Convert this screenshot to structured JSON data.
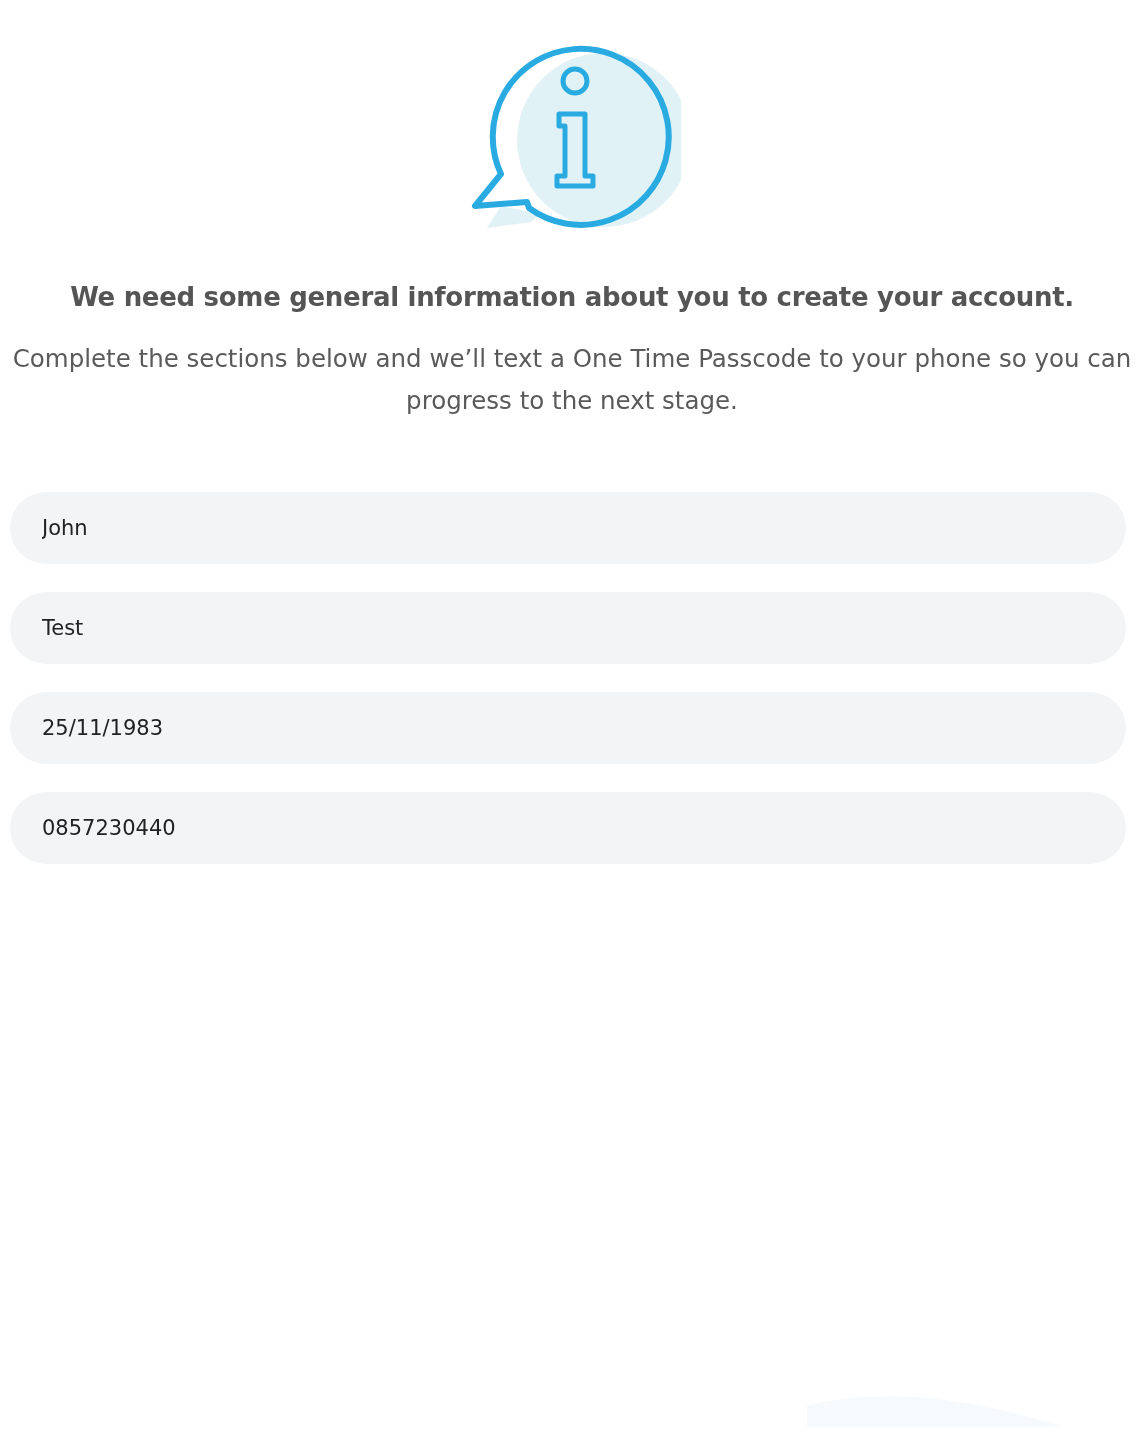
{
  "heading": "We need some general information about you to create your account.",
  "intro": "Complete the sections below and we’ll text a One Time Passcode to your phone so you can progress to the next stage.",
  "fields": [
    {
      "value": "John"
    },
    {
      "value": "Test"
    },
    {
      "value": "25/11/1983"
    },
    {
      "value": "0857230440"
    }
  ]
}
